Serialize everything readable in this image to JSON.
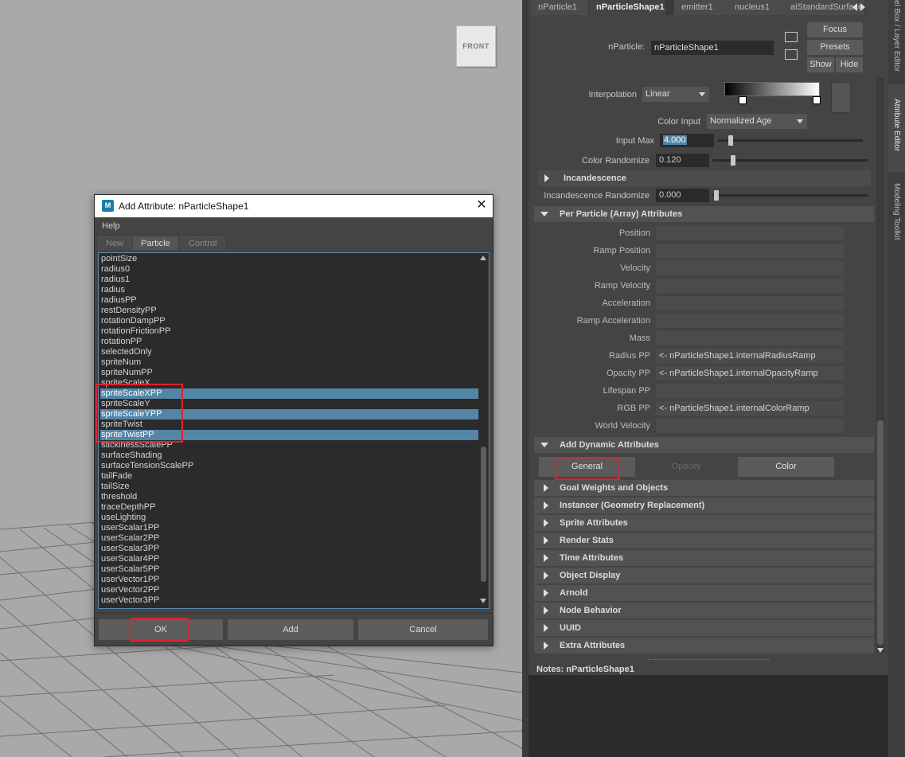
{
  "viewport": {
    "view_cube_label": "FRONT"
  },
  "dialog": {
    "title": "Add Attribute: nParticleShape1",
    "icon_text": "M",
    "menu_help": "Help",
    "tabs": [
      "New",
      "Particle",
      "Control"
    ],
    "active_tab": "Particle",
    "items": [
      "pointSize",
      "radius0",
      "radius1",
      "radius",
      "radiusPP",
      "restDensityPP",
      "rotationDampPP",
      "rotationFrictionPP",
      "rotationPP",
      "selectedOnly",
      "spriteNum",
      "spriteNumPP",
      "spriteScaleX",
      "spriteScaleXPP",
      "spriteScaleY",
      "spriteScaleYPP",
      "spriteTwist",
      "spriteTwistPP",
      "stickinessScalePP",
      "surfaceShading",
      "surfaceTensionScalePP",
      "tailFade",
      "tailSize",
      "threshold",
      "traceDepthPP",
      "useLighting",
      "userScalar1PP",
      "userScalar2PP",
      "userScalar3PP",
      "userScalar4PP",
      "userScalar5PP",
      "userVector1PP",
      "userVector2PP",
      "userVector3PP"
    ],
    "selected_items": [
      "spriteScaleXPP",
      "spriteScaleYPP",
      "spriteTwistPP"
    ],
    "buttons": {
      "ok": "OK",
      "add": "Add",
      "cancel": "Cancel"
    }
  },
  "editor": {
    "tabs": [
      "nParticle1",
      "nParticleShape1",
      "emitter1",
      "nucleus1",
      "aiStandardSurface"
    ],
    "active_tab": "nParticleShape1",
    "node_label": "nParticle:",
    "node_name": "nParticleShape1",
    "buttons": {
      "focus": "Focus",
      "presets": "Presets",
      "show": "Show",
      "hide": "Hide"
    },
    "interpolation_label": "Interpolation",
    "interpolation_value": "Linear",
    "color_input_label": "Color Input",
    "color_input_value": "Normalized Age",
    "input_max_label": "Input Max",
    "input_max_value": "4.000",
    "color_randomize_label": "Color Randomize",
    "color_randomize_value": "0.120",
    "incandescence_section": "Incandescence",
    "incandescence_randomize_label": "Incandescence Randomize",
    "incandescence_randomize_value": "0.000",
    "per_particle_section": "Per Particle (Array) Attributes",
    "per_particle": [
      {
        "label": "Position",
        "value": ""
      },
      {
        "label": "Ramp Position",
        "value": ""
      },
      {
        "label": "Velocity",
        "value": ""
      },
      {
        "label": "Ramp Velocity",
        "value": ""
      },
      {
        "label": "Acceleration",
        "value": ""
      },
      {
        "label": "Ramp Acceleration",
        "value": ""
      },
      {
        "label": "Mass",
        "value": ""
      },
      {
        "label": "Radius PP",
        "value": "<- nParticleShape1.internalRadiusRamp"
      },
      {
        "label": "Opacity PP",
        "value": "<- nParticleShape1.internalOpacityRamp"
      },
      {
        "label": "Lifespan PP",
        "value": ""
      },
      {
        "label": "RGB PP",
        "value": "<- nParticleShape1.internalColorRamp"
      },
      {
        "label": "World Velocity",
        "value": ""
      }
    ],
    "add_dynamic_section": "Add Dynamic Attributes",
    "dynamic_buttons": {
      "general": "General",
      "opacity": "Opacity",
      "color": "Color"
    },
    "collapsed_sections": [
      "Goal Weights and Objects",
      "Instancer (Geometry Replacement)",
      "Sprite Attributes",
      "Render Stats",
      "Time Attributes",
      "Object Display",
      "Arnold",
      "Node Behavior",
      "UUID",
      "Extra Attributes"
    ],
    "notes_label": "Notes:",
    "notes_node": "nParticleShape1"
  },
  "sidebar": {
    "tabs": [
      "el Box / Layer Editor",
      "Attribute Editor",
      "Modeling Toolkit"
    ]
  },
  "colors": {
    "selection": "#5285a6",
    "highlight_box": "#e0222d",
    "field_active": "#5285a6"
  }
}
